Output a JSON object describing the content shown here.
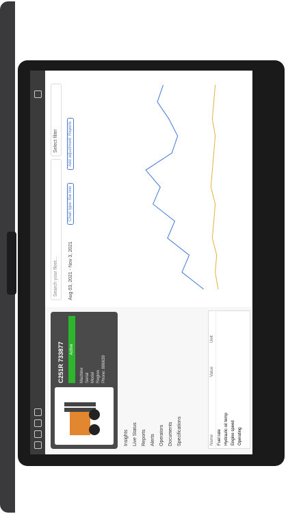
{
  "app": {
    "search_placeholder": "Search your fleet...",
    "filter_label": "Select filter",
    "date_range": "Aug 03, 2021 - Nov 3, 2021",
    "buttons": [
      "Chart type: Bar line",
      "Add adjustment: Reports"
    ]
  },
  "machine": {
    "name": "C251R 733877",
    "status": "Active",
    "meta_lines": [
      "Machine",
      "Serial",
      "Model",
      "Region",
      "Phone: 886639"
    ]
  },
  "nav": {
    "items": [
      "Insights",
      "Live Status",
      "Reports",
      "Alerts",
      "Operators",
      "Documents",
      "Specifications"
    ]
  },
  "table": {
    "columns": [
      "Name",
      "Value",
      "Unit"
    ],
    "rows": [
      [
        "Fuel rate",
        "",
        ""
      ],
      [
        "Hydraulic oil temp",
        "",
        ""
      ],
      [
        "Engine speed",
        "",
        ""
      ],
      [
        "Operating",
        "",
        ""
      ]
    ]
  },
  "chart_data": {
    "type": "line",
    "title": "",
    "series": [
      {
        "name": "",
        "values": [
          20,
          35,
          30,
          45,
          40,
          55,
          50,
          60,
          42,
          38,
          44,
          52,
          48
        ]
      },
      {
        "name": "",
        "values": [
          10,
          12,
          11,
          14,
          13,
          12,
          15,
          14,
          13,
          12,
          14,
          13,
          12
        ]
      }
    ],
    "x": [
      1,
      2,
      3,
      4,
      5,
      6,
      7,
      8,
      9,
      10,
      11,
      12,
      13
    ],
    "ylim": [
      0,
      70
    ]
  },
  "colors": {
    "series1": "#3f78d8",
    "series2": "#e2b23c",
    "series3": "#35a84a"
  }
}
